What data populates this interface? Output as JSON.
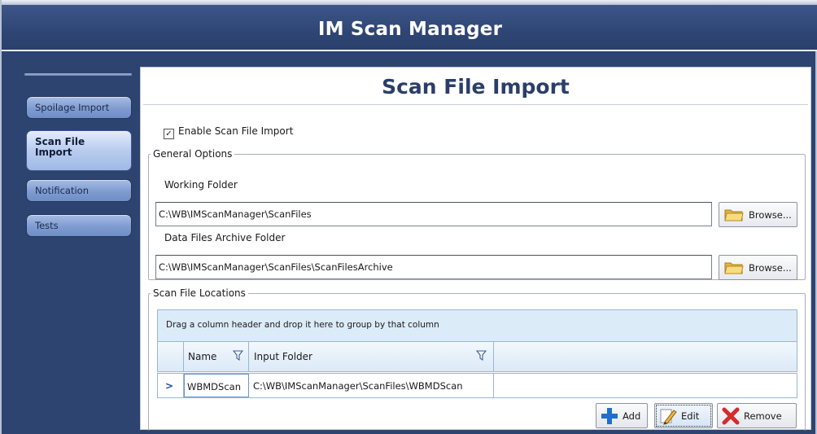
{
  "app": {
    "title": "IM Scan Manager"
  },
  "sidebar": {
    "items": [
      {
        "label": "Spoilage Import"
      },
      {
        "label_lines": [
          "Scan File",
          "Import"
        ]
      },
      {
        "label": "Notification"
      },
      {
        "label": "Tests"
      }
    ]
  },
  "page": {
    "title": "Scan File Import",
    "enable_checkbox": {
      "label": "Enable Scan File Import",
      "checked": true
    }
  },
  "general_options": {
    "legend": "General Options",
    "working_folder": {
      "label": "Working Folder",
      "value": "C:\\WB\\IMScanManager\\ScanFiles",
      "browse_label": "Browse..."
    },
    "archive_folder": {
      "label": "Data Files Archive Folder",
      "value": "C:\\WB\\IMScanManager\\ScanFiles\\ScanFilesArchive",
      "browse_label": "Browse..."
    }
  },
  "scan_file_locations": {
    "legend": "Scan File Locations",
    "group_hint": "Drag a column header and drop it here to group by that column",
    "columns": [
      "Name",
      "Input Folder"
    ],
    "rows": [
      {
        "indicator": ">",
        "name": "WBMDScan",
        "input_folder": "C:\\WB\\IMScanManager\\ScanFiles\\WBMDScan"
      }
    ],
    "actions": {
      "add": "Add",
      "edit": "Edit",
      "remove": "Remove"
    }
  },
  "colors": {
    "frame_navy": "#2d4370",
    "title_text": "#2a3e68",
    "selected_nav": "#b9ccee",
    "grid_header": "#dbe9f7"
  }
}
